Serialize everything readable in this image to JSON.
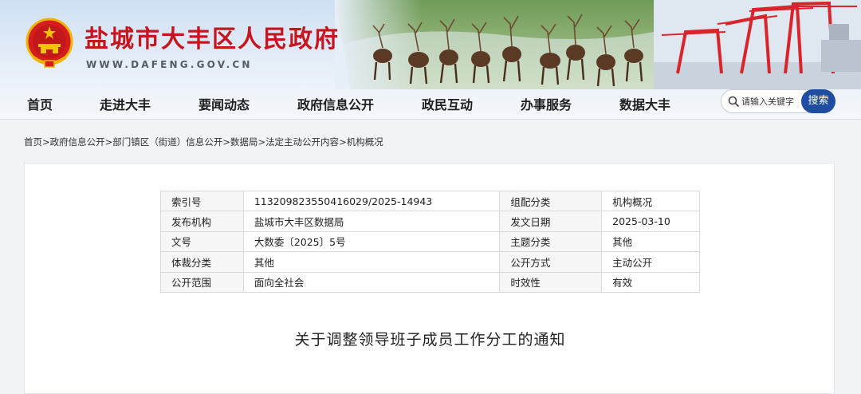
{
  "site": {
    "name": "盐城市大丰区人民政府",
    "url": "WWW.DAFENG.GOV.CN"
  },
  "nav": {
    "items": [
      {
        "label": "首页"
      },
      {
        "label": "走进大丰"
      },
      {
        "label": "要闻动态"
      },
      {
        "label": "政府信息公开"
      },
      {
        "label": "政民互动"
      },
      {
        "label": "办事服务"
      },
      {
        "label": "数据大丰"
      }
    ]
  },
  "search": {
    "placeholder": "请输入关键字",
    "button_label": "搜索"
  },
  "breadcrumb": {
    "items": [
      "首页",
      "政府信息公开",
      "部门镇区（街道）信息公开",
      "数据局",
      "法定主动公开内容",
      "机构概况"
    ],
    "separator": ">"
  },
  "meta_table": {
    "rows": [
      [
        {
          "k": "索引号",
          "v": "113209823550416029/2025-14943"
        },
        {
          "k": "组配分类",
          "v": "机构概况"
        }
      ],
      [
        {
          "k": "发布机构",
          "v": "盐城市大丰区数据局"
        },
        {
          "k": "发文日期",
          "v": "2025-03-10"
        }
      ],
      [
        {
          "k": "文号",
          "v": "大数委〔2025〕5号"
        },
        {
          "k": "主题分类",
          "v": "其他"
        }
      ],
      [
        {
          "k": "体裁分类",
          "v": "其他"
        },
        {
          "k": "公开方式",
          "v": "主动公开"
        }
      ],
      [
        {
          "k": "公开范围",
          "v": "面向全社会"
        },
        {
          "k": "时效性",
          "v": "有效"
        }
      ]
    ]
  },
  "document": {
    "title": "关于调整领导班子成员工作分工的通知"
  },
  "colors": {
    "brand_red": "#c8141e",
    "search_button": "#1f4ea0",
    "url_gray": "#545b66"
  }
}
